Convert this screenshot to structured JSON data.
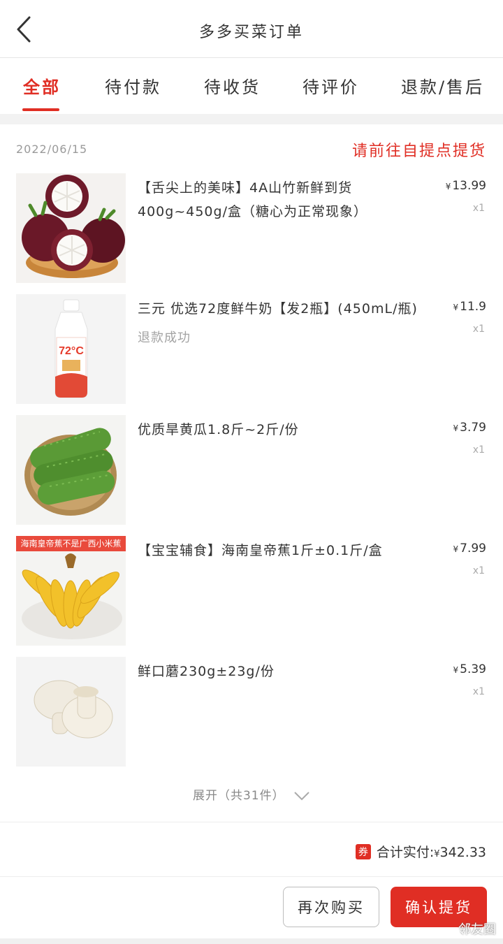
{
  "header": {
    "title": "多多买菜订单"
  },
  "tabs": [
    {
      "label": "全部"
    },
    {
      "label": "待付款"
    },
    {
      "label": "待收货"
    },
    {
      "label": "待评价"
    },
    {
      "label": "退款/售后"
    }
  ],
  "order": {
    "date": "2022/06/15",
    "status": "请前往自提点提货",
    "items": [
      {
        "name": "【舌尖上的美味】4A山竹新鲜到货400g~450g/盒（糖心为正常现象）",
        "sub": "",
        "price": "13.99",
        "qty": "x1",
        "image": "mangosteen"
      },
      {
        "name": "三元 优选72度鲜牛奶【发2瓶】(450mL/瓶)",
        "sub": "退款成功",
        "price": "11.9",
        "qty": "x1",
        "image": "milk-bottle"
      },
      {
        "name": "优质旱黄瓜1.8斤~2斤/份",
        "sub": "",
        "price": "3.79",
        "qty": "x1",
        "image": "cucumbers"
      },
      {
        "name": "【宝宝辅食】海南皇帝蕉1斤±0.1斤/盒",
        "sub": "",
        "price": "7.99",
        "qty": "x1",
        "image": "bananas",
        "banner": "海南皇帝蕉不是广西小米蕉"
      },
      {
        "name": "鲜口蘑230g±23g/份",
        "sub": "",
        "price": "5.39",
        "qty": "x1",
        "image": "mushrooms"
      }
    ],
    "expand_label": "展开（共31件）",
    "coupon_label": "券",
    "total_label": "合计实付:",
    "currency": "¥",
    "total_value": "342.33"
  },
  "actions": {
    "buy_again": "再次购买",
    "confirm_pickup": "确认提货"
  },
  "watermark": "邻友圈",
  "colors": {
    "accent": "#e02e24"
  }
}
